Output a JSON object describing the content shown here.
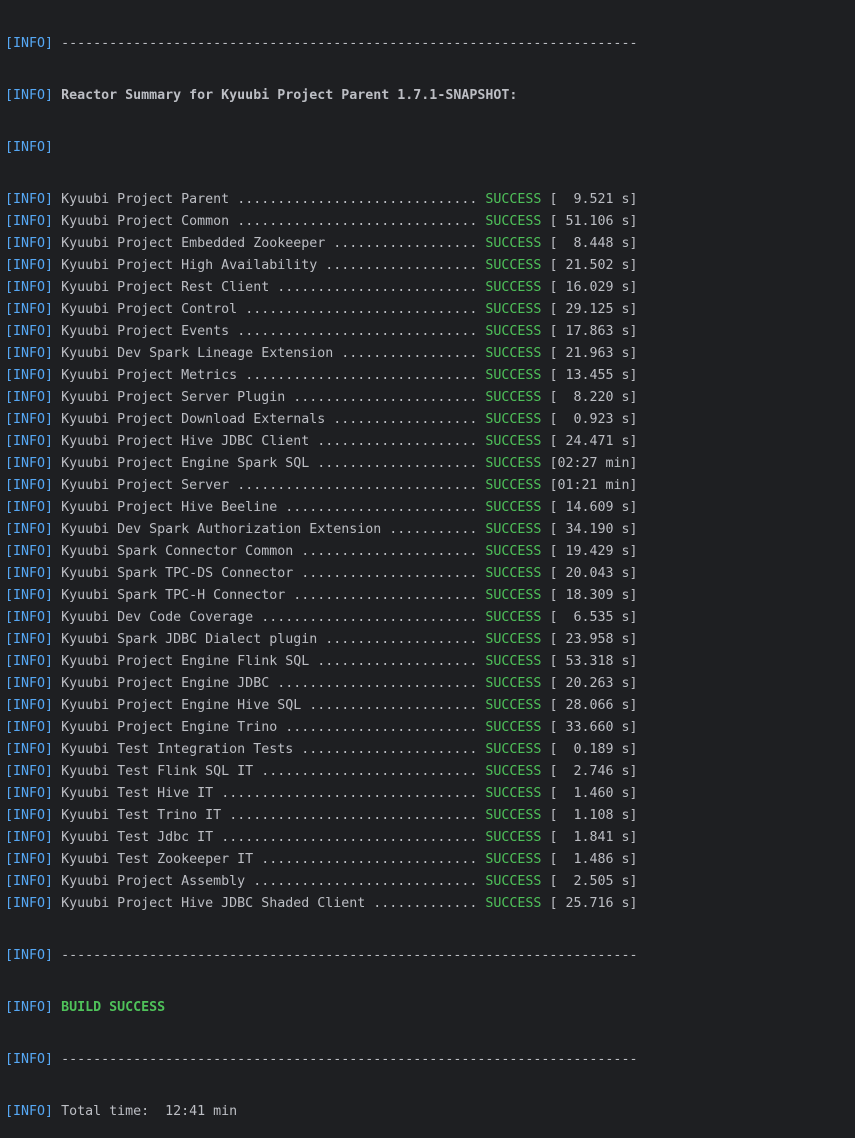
{
  "tag": "[INFO]",
  "colors": {
    "background": "#1e1f22",
    "text": "#bcbec4",
    "tag": "#56a8f5",
    "success": "#4fc25a"
  },
  "header": {
    "separator": "------------------------------------------------------------------------",
    "title": "Reactor Summary for Kyuubi Project Parent 1.7.1-SNAPSHOT:",
    "blank": ""
  },
  "modules": [
    {
      "name": "Kyuubi Project Parent",
      "dots": "..............................",
      "status": "SUCCESS",
      "time": "[  9.521 s]"
    },
    {
      "name": "Kyuubi Project Common",
      "dots": "..............................",
      "status": "SUCCESS",
      "time": "[ 51.106 s]"
    },
    {
      "name": "Kyuubi Project Embedded Zookeeper",
      "dots": "..................",
      "status": "SUCCESS",
      "time": "[  8.448 s]"
    },
    {
      "name": "Kyuubi Project High Availability",
      "dots": "...................",
      "status": "SUCCESS",
      "time": "[ 21.502 s]"
    },
    {
      "name": "Kyuubi Project Rest Client",
      "dots": ".........................",
      "status": "SUCCESS",
      "time": "[ 16.029 s]"
    },
    {
      "name": "Kyuubi Project Control",
      "dots": ".............................",
      "status": "SUCCESS",
      "time": "[ 29.125 s]"
    },
    {
      "name": "Kyuubi Project Events",
      "dots": "..............................",
      "status": "SUCCESS",
      "time": "[ 17.863 s]"
    },
    {
      "name": "Kyuubi Dev Spark Lineage Extension",
      "dots": ".................",
      "status": "SUCCESS",
      "time": "[ 21.963 s]"
    },
    {
      "name": "Kyuubi Project Metrics",
      "dots": ".............................",
      "status": "SUCCESS",
      "time": "[ 13.455 s]"
    },
    {
      "name": "Kyuubi Project Server Plugin",
      "dots": ".......................",
      "status": "SUCCESS",
      "time": "[  8.220 s]"
    },
    {
      "name": "Kyuubi Project Download Externals",
      "dots": "..................",
      "status": "SUCCESS",
      "time": "[  0.923 s]"
    },
    {
      "name": "Kyuubi Project Hive JDBC Client",
      "dots": "....................",
      "status": "SUCCESS",
      "time": "[ 24.471 s]"
    },
    {
      "name": "Kyuubi Project Engine Spark SQL",
      "dots": "....................",
      "status": "SUCCESS",
      "time": "[02:27 min]"
    },
    {
      "name": "Kyuubi Project Server",
      "dots": "..............................",
      "status": "SUCCESS",
      "time": "[01:21 min]"
    },
    {
      "name": "Kyuubi Project Hive Beeline",
      "dots": "........................",
      "status": "SUCCESS",
      "time": "[ 14.609 s]"
    },
    {
      "name": "Kyuubi Dev Spark Authorization Extension",
      "dots": "...........",
      "status": "SUCCESS",
      "time": "[ 34.190 s]"
    },
    {
      "name": "Kyuubi Spark Connector Common",
      "dots": "......................",
      "status": "SUCCESS",
      "time": "[ 19.429 s]"
    },
    {
      "name": "Kyuubi Spark TPC-DS Connector",
      "dots": "......................",
      "status": "SUCCESS",
      "time": "[ 20.043 s]"
    },
    {
      "name": "Kyuubi Spark TPC-H Connector",
      "dots": ".......................",
      "status": "SUCCESS",
      "time": "[ 18.309 s]"
    },
    {
      "name": "Kyuubi Dev Code Coverage",
      "dots": "...........................",
      "status": "SUCCESS",
      "time": "[  6.535 s]"
    },
    {
      "name": "Kyuubi Spark JDBC Dialect plugin",
      "dots": "...................",
      "status": "SUCCESS",
      "time": "[ 23.958 s]"
    },
    {
      "name": "Kyuubi Project Engine Flink SQL",
      "dots": "....................",
      "status": "SUCCESS",
      "time": "[ 53.318 s]"
    },
    {
      "name": "Kyuubi Project Engine JDBC",
      "dots": ".........................",
      "status": "SUCCESS",
      "time": "[ 20.263 s]"
    },
    {
      "name": "Kyuubi Project Engine Hive SQL",
      "dots": ".....................",
      "status": "SUCCESS",
      "time": "[ 28.066 s]"
    },
    {
      "name": "Kyuubi Project Engine Trino",
      "dots": "........................",
      "status": "SUCCESS",
      "time": "[ 33.660 s]"
    },
    {
      "name": "Kyuubi Test Integration Tests",
      "dots": "......................",
      "status": "SUCCESS",
      "time": "[  0.189 s]"
    },
    {
      "name": "Kyuubi Test Flink SQL IT",
      "dots": "...........................",
      "status": "SUCCESS",
      "time": "[  2.746 s]"
    },
    {
      "name": "Kyuubi Test Hive IT",
      "dots": "................................",
      "status": "SUCCESS",
      "time": "[  1.460 s]"
    },
    {
      "name": "Kyuubi Test Trino IT",
      "dots": "...............................",
      "status": "SUCCESS",
      "time": "[  1.108 s]"
    },
    {
      "name": "Kyuubi Test Jdbc IT",
      "dots": "................................",
      "status": "SUCCESS",
      "time": "[  1.841 s]"
    },
    {
      "name": "Kyuubi Test Zookeeper IT",
      "dots": "...........................",
      "status": "SUCCESS",
      "time": "[  1.486 s]"
    },
    {
      "name": "Kyuubi Project Assembly",
      "dots": "............................",
      "status": "SUCCESS",
      "time": "[  2.505 s]"
    },
    {
      "name": "Kyuubi Project Hive JDBC Shaded Client",
      "dots": ".............",
      "status": "SUCCESS",
      "time": "[ 25.716 s]"
    }
  ],
  "footer": {
    "separator1": "------------------------------------------------------------------------",
    "build_status": "BUILD SUCCESS",
    "separator2": "------------------------------------------------------------------------",
    "total_time": "Total time:  12:41 min"
  }
}
